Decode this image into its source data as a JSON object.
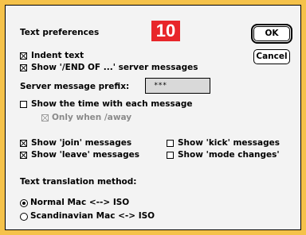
{
  "badge": "10",
  "dialog": {
    "title": "Text preferences",
    "ok_label": "OK",
    "cancel_label": "Cancel",
    "indent_text": {
      "label": "Indent text",
      "checked": true
    },
    "show_end_of": {
      "label": "Show '/END OF ...' server messages",
      "checked": true
    },
    "server_prefix": {
      "label": "Server message prefix:",
      "value": "***"
    },
    "show_time": {
      "label": "Show the time with each message",
      "checked": false
    },
    "only_when_away": {
      "label": "Only when /away",
      "checked": true,
      "enabled": false
    },
    "show_join": {
      "label": "Show 'join' messages",
      "checked": true
    },
    "show_leave": {
      "label": "Show 'leave' messages",
      "checked": true
    },
    "show_kick": {
      "label": "Show 'kick' messages",
      "checked": false
    },
    "show_mode": {
      "label": "Show 'mode changes'",
      "checked": false
    },
    "translation": {
      "label": "Text translation method:",
      "options": [
        "Normal Mac <--> ISO",
        "Scandinavian Mac <-> ISO"
      ],
      "selected": 0
    }
  }
}
